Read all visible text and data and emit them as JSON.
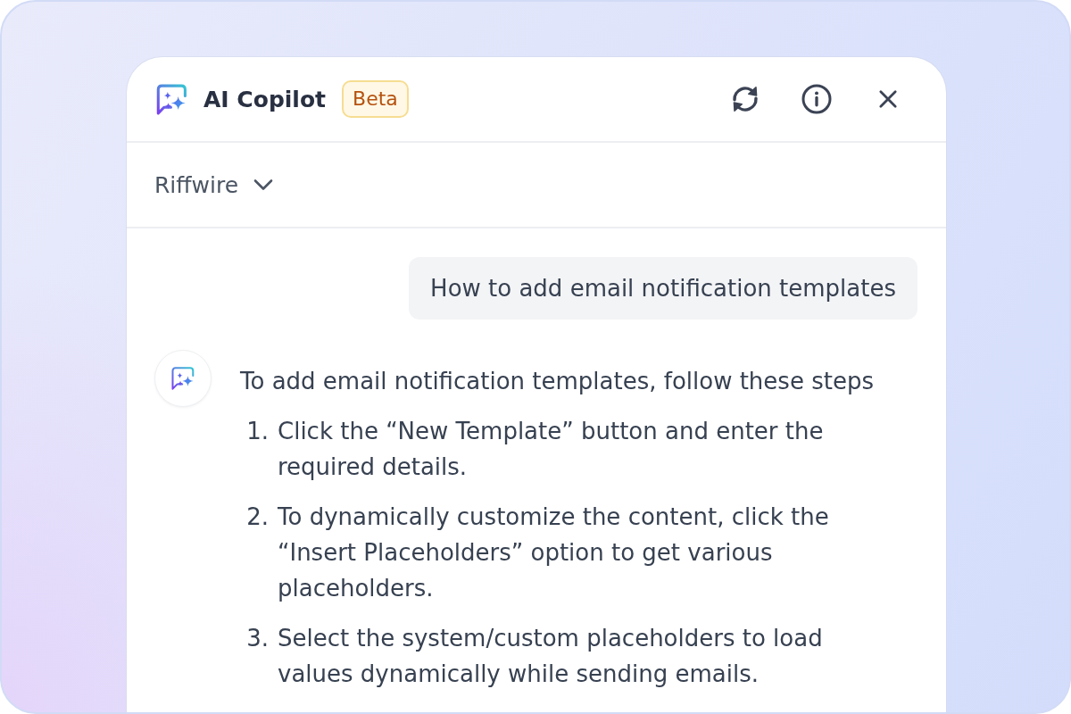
{
  "header": {
    "title": "AI Copilot",
    "badge": "Beta"
  },
  "workspace_selector": {
    "value": "Riffwire"
  },
  "messages": [
    {
      "kind": "user",
      "text": "How to add email notification templates"
    },
    {
      "kind": "assistant",
      "intro": "To add email notification templates, follow these steps",
      "steps": [
        {
          "number": "1.",
          "text": "Click the “New Template” button and enter the required details."
        },
        {
          "number": "2.",
          "text": "To dynamically customize the content, click the “Insert Placeholders” option to get various placeholders."
        },
        {
          "number": "3.",
          "text": "Select the system/custom placeholders to load values dynamically while sending emails."
        }
      ]
    }
  ]
}
